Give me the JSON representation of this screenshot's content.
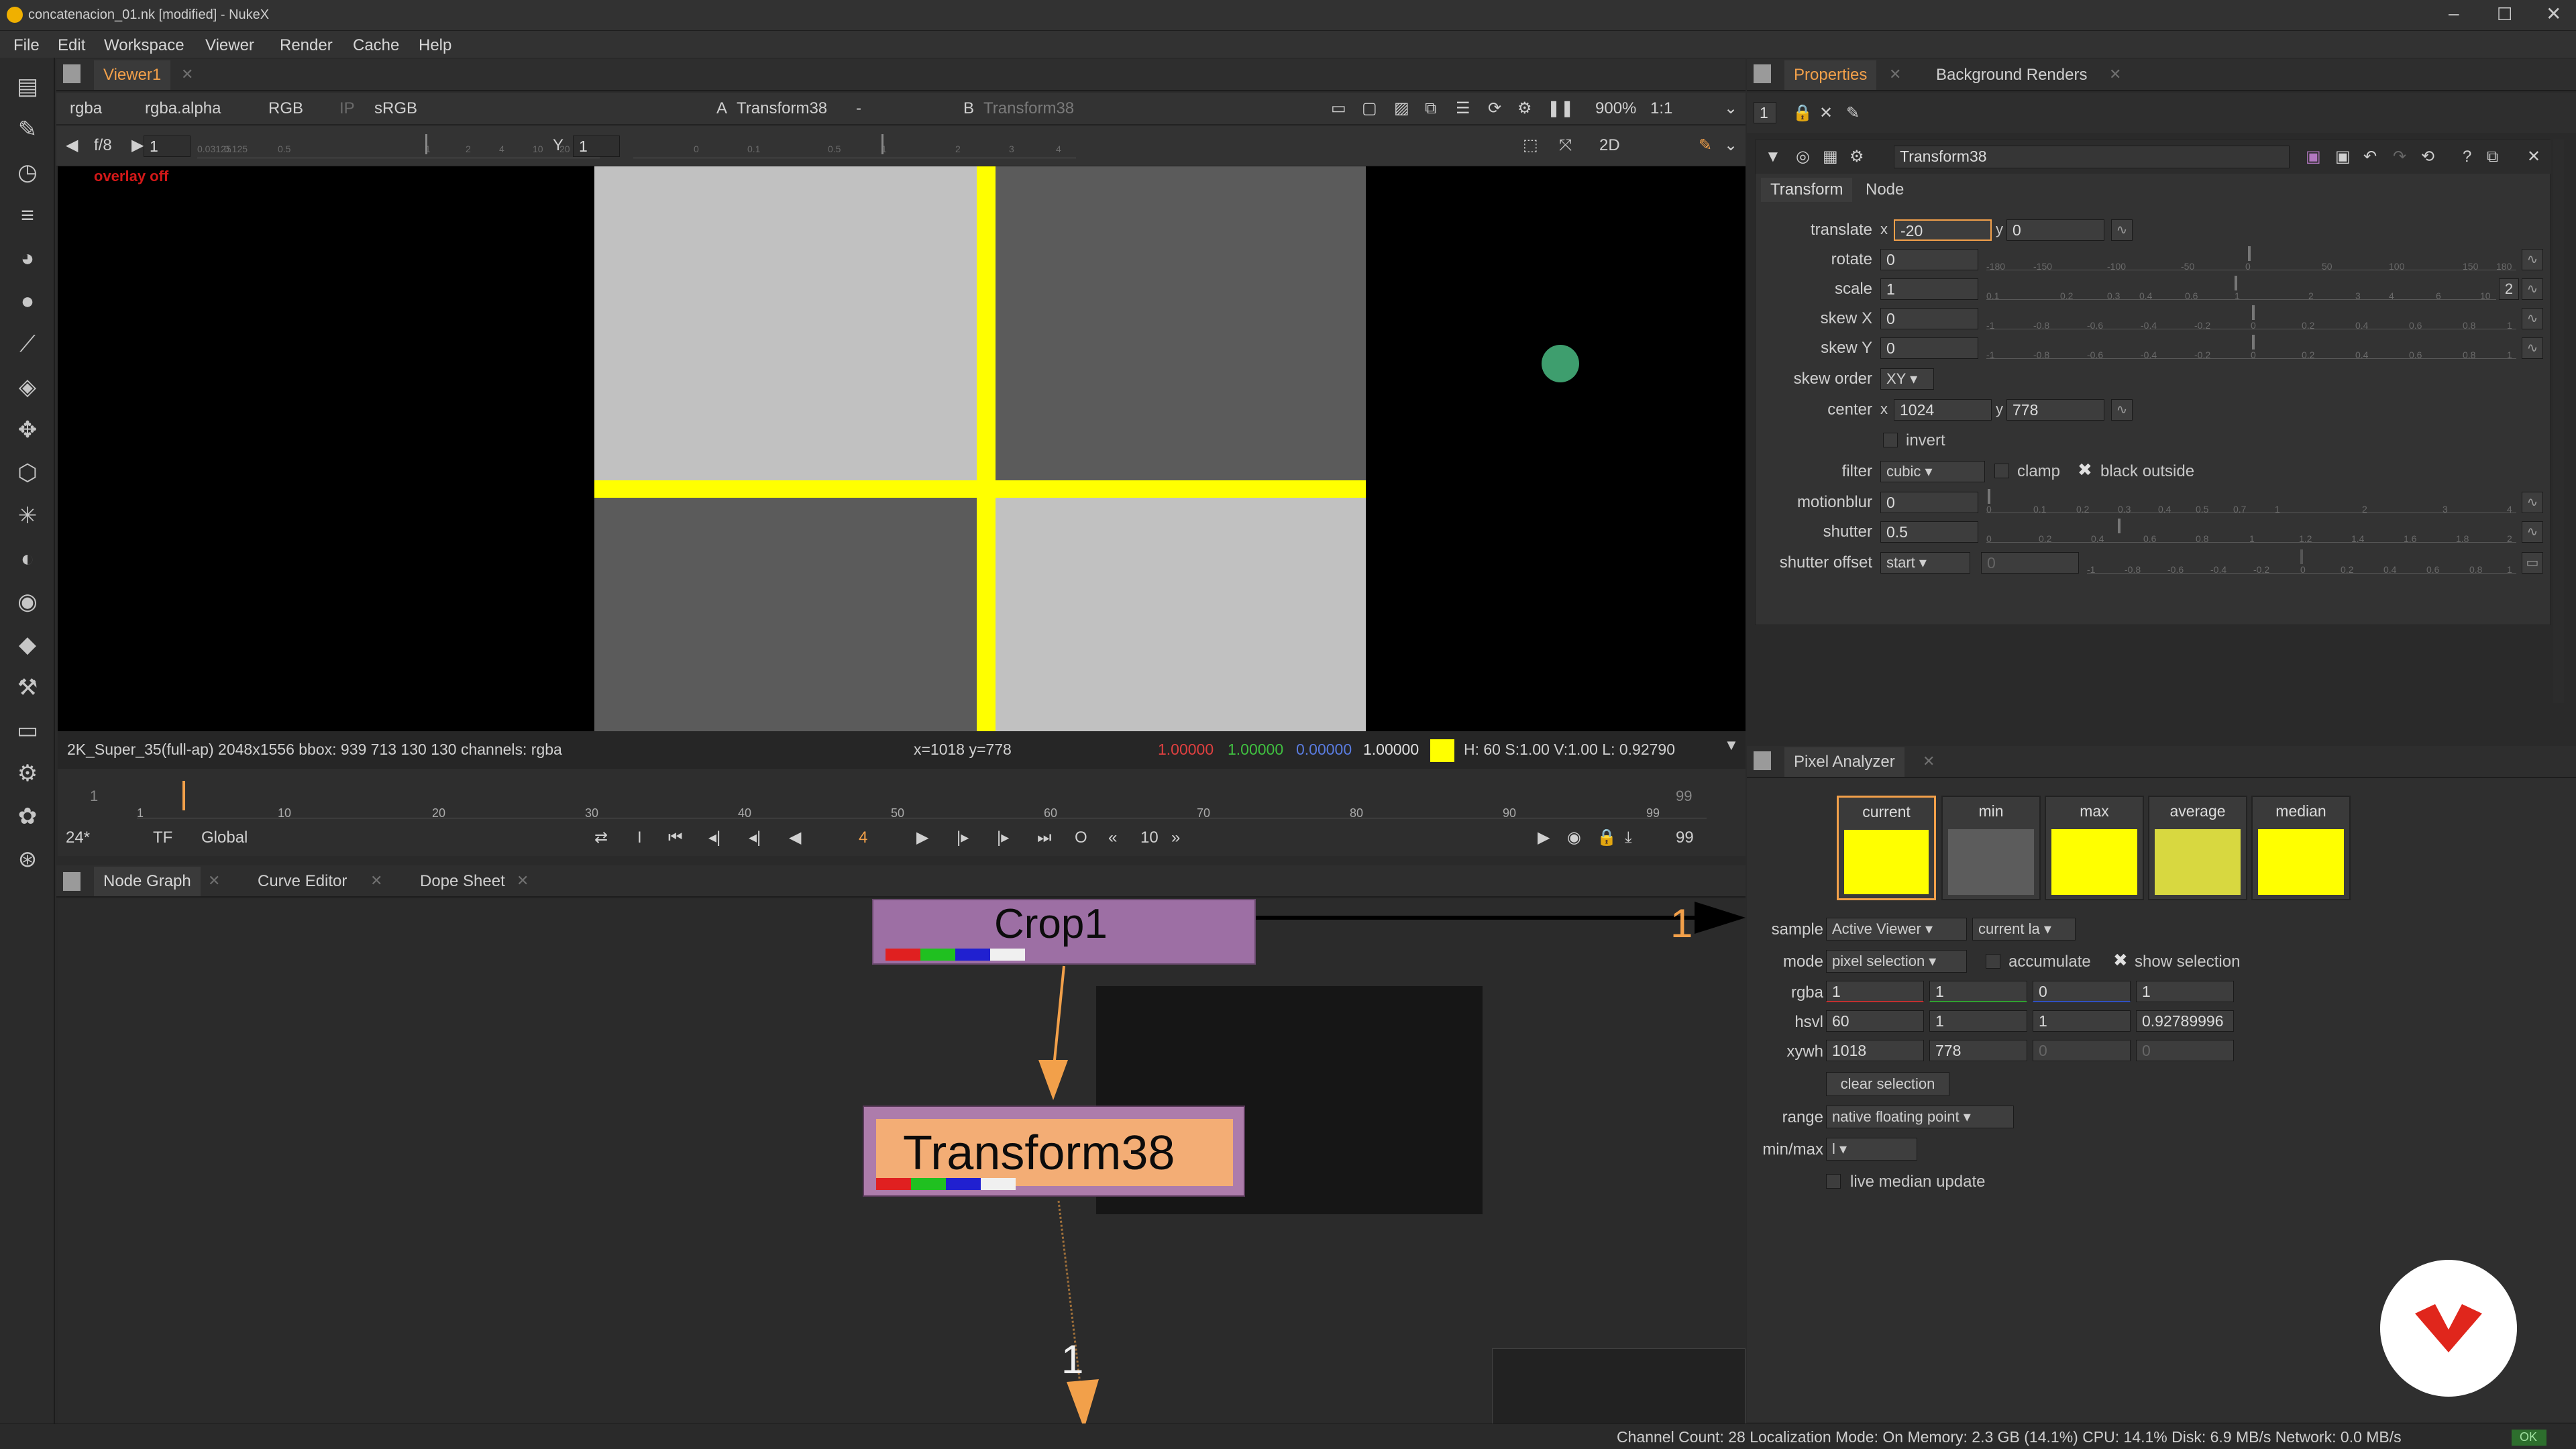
{
  "window": {
    "title": "concatenacion_01.nk [modified] - NukeX"
  },
  "menu": [
    "File",
    "Edit",
    "Workspace",
    "Viewer",
    "Render",
    "Cache",
    "Help"
  ],
  "viewer": {
    "tab": "Viewer1",
    "channels": "rgba",
    "alpha": "rgba.alpha",
    "display_channels": "RGB",
    "ip": "IP",
    "lut": "sRGB",
    "input_a_label": "A",
    "input_a": "Transform38",
    "wipe": "-",
    "input_b_label": "B",
    "input_b": "Transform38",
    "zoom": "900%",
    "ratio": "1:1",
    "fstop": "f/8",
    "frame_gain": "1",
    "gamma_label": "Y",
    "gamma": "1",
    "view_mode": "2D",
    "overlay": "overlay off",
    "status_format": "2K_Super_35(full-ap) 2048x1556  bbox: 939 713 130 130 channels: rgba",
    "status_xy": "x=1018 y=778",
    "status_r": "1.00000",
    "status_g": "1.00000",
    "status_b": "0.00000",
    "status_a": "1.00000",
    "status_hsvl": "H: 60 S:1.00 V:1.00   L: 0.92790",
    "gain_ticks": [
      "0.03125",
      "0.125",
      "0.5",
      "1",
      "2",
      "4",
      "10",
      "20",
      "64"
    ],
    "gamma_ticks": [
      "0",
      "0.1",
      "0.5",
      "1",
      "2",
      "3",
      "4"
    ]
  },
  "timeline": {
    "start": "1",
    "end": "99",
    "current": "4",
    "ticks": [
      "1",
      "10",
      "20",
      "30",
      "40",
      "50",
      "60",
      "70",
      "80",
      "90",
      "99"
    ],
    "fps": "24*",
    "tf": "TF",
    "scope": "Global",
    "step": "10",
    "end_field": "99",
    "in_label": "I",
    "out_label": "O"
  },
  "bottom_tabs": [
    "Node Graph",
    "Curve Editor",
    "Dope Sheet"
  ],
  "nodes": {
    "crop": "Crop1",
    "transform": "Transform38",
    "pipe_label_1": "1",
    "pipe_label_2": "1"
  },
  "right_tabs": {
    "properties": "Properties",
    "bg_renders": "Background Renders"
  },
  "properties": {
    "node_name": "Transform38",
    "tabs": [
      "Transform",
      "Node"
    ],
    "translate_label": "translate",
    "translate_x_label": "x",
    "translate_x": "-20",
    "translate_y_label": "y",
    "translate_y": "0",
    "rotate_label": "rotate",
    "rotate": "0",
    "scale_label": "scale",
    "scale": "1",
    "scale_chan_btn": "2",
    "skewx_label": "skew X",
    "skewx": "0",
    "skewy_label": "skew Y",
    "skewy": "0",
    "skew_order_label": "skew order",
    "skew_order": "XY",
    "center_label": "center",
    "center_x_label": "x",
    "center_x": "1024",
    "center_y_label": "y",
    "center_y": "778",
    "invert": "invert",
    "filter_label": "filter",
    "filter": "cubic",
    "clamp": "clamp",
    "black_outside": "black outside",
    "motionblur_label": "motionblur",
    "motionblur": "0",
    "shutter_label": "shutter",
    "shutter": "0.5",
    "shutter_offset_label": "shutter offset",
    "shutter_offset": "start",
    "shutter_offset_value": "0",
    "rotate_ticks": [
      "-180",
      "-150",
      "-100",
      "-50",
      "0",
      "50",
      "100",
      "150",
      "180"
    ],
    "scale_ticks": [
      "0.1",
      "0.2",
      "0.3",
      "0.4",
      "0.6",
      "1",
      "2",
      "3",
      "4",
      "6",
      "10"
    ],
    "skew_ticks": [
      "-1",
      "-0.8",
      "-0.6",
      "-0.4",
      "-0.2",
      "0",
      "0.2",
      "0.4",
      "0.6",
      "0.8",
      "1"
    ],
    "mb_ticks": [
      "0",
      "0.1",
      "0.2",
      "0.3",
      "0.4",
      "0.5",
      "0.7",
      "1",
      "2",
      "3",
      "4"
    ],
    "shutter_ticks": [
      "0",
      "0.2",
      "0.4",
      "0.6",
      "0.8",
      "1",
      "1.2",
      "1.4",
      "1.6",
      "1.8",
      "2"
    ]
  },
  "pixel_analyzer": {
    "title": "Pixel Analyzer",
    "swatches": [
      {
        "label": "current",
        "color": "#ffff00"
      },
      {
        "label": "min",
        "color": "#5c5c5c"
      },
      {
        "label": "max",
        "color": "#ffff00"
      },
      {
        "label": "average",
        "color": "#d8d840"
      },
      {
        "label": "median",
        "color": "#ffff00"
      }
    ],
    "sample_label": "sample",
    "sample": "Active Viewer",
    "sample_input": "current la",
    "mode_label": "mode",
    "mode": "pixel selection",
    "accumulate": "accumulate",
    "show_selection": "show selection",
    "rgba_label": "rgba",
    "rgba": [
      "1",
      "1",
      "0",
      "1"
    ],
    "hsvl_label": "hsvl",
    "hsvl": [
      "60",
      "1",
      "1",
      "0.92789996"
    ],
    "xywh_label": "xywh",
    "xywh": [
      "1018",
      "778",
      "0",
      "0"
    ],
    "clear_selection": "clear selection",
    "range_label": "range",
    "range": "native floating point",
    "minmax_label": "min/max",
    "minmax": "l",
    "live_median": "live median update"
  },
  "statusbar": "Channel Count: 28  Localization Mode: On  Memory: 2.3 GB (14.1%)  CPU: 14.1%  Disk: 6.9 MB/s  Network: 0.0 MB/s",
  "statusbar_ok": "OK",
  "colors": {
    "accent": "#f2a04a",
    "yellow": "#ffff00",
    "crop_node": "#9d6fa4",
    "transform_node": "#ffb66b"
  }
}
